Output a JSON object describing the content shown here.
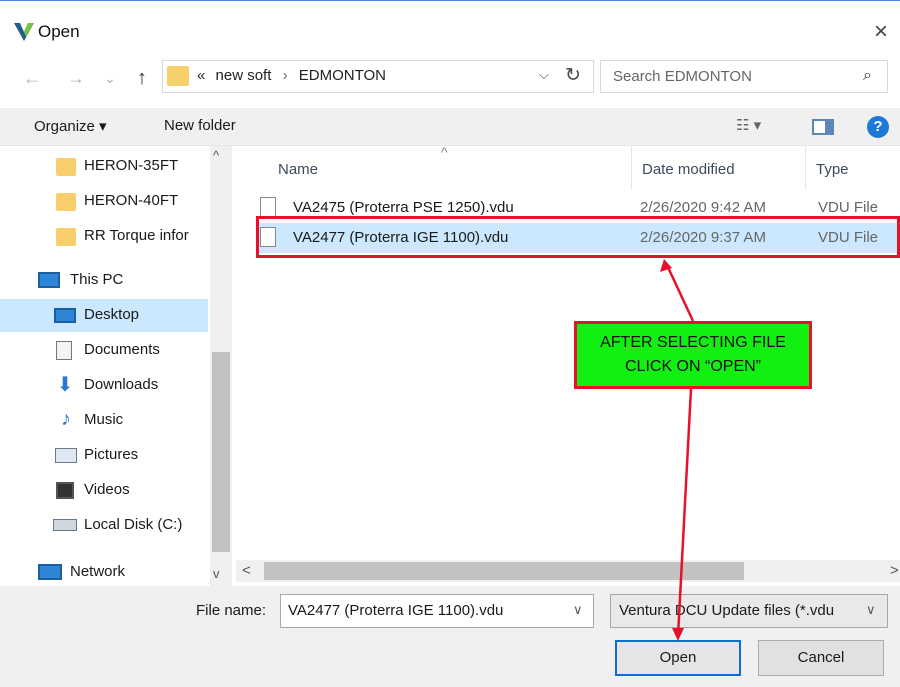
{
  "window": {
    "title": "Open",
    "close_icon": "×"
  },
  "nav": {
    "back_icon": "←",
    "forward_icon": "→",
    "recent_icon": "⌄",
    "up_icon": "↑",
    "breadcrumb_prefix": "«",
    "breadcrumb": [
      "new soft",
      "EDMONTON"
    ],
    "dropdown_icon": "⌵",
    "refresh_icon": "↻",
    "search_placeholder": "Search EDMONTON",
    "search_icon": "⌕"
  },
  "toolbar": {
    "organize_label": "Organize ▾",
    "new_folder_label": "New folder",
    "view_label": "☷ ▾",
    "help_label": "?"
  },
  "sidebar": {
    "items": [
      {
        "label": "HERON-35FT",
        "icon": "folder-icon"
      },
      {
        "label": "HERON-40FT",
        "icon": "folder-icon"
      },
      {
        "label": "RR Torque infor",
        "icon": "folder-icon"
      },
      {
        "label": "This PC",
        "icon": "pc-icon"
      },
      {
        "label": "Desktop",
        "icon": "desktop-icon",
        "selected": true
      },
      {
        "label": "Documents",
        "icon": "documents-icon"
      },
      {
        "label": "Downloads",
        "icon": "downloads-icon"
      },
      {
        "label": "Music",
        "icon": "music-icon"
      },
      {
        "label": "Pictures",
        "icon": "pictures-icon"
      },
      {
        "label": "Videos",
        "icon": "videos-icon"
      },
      {
        "label": "Local Disk (C:)",
        "icon": "drive-icon"
      },
      {
        "label": "Network",
        "icon": "network-icon"
      }
    ],
    "scroll_up": "^",
    "scroll_down": "v"
  },
  "files": {
    "columns": [
      "Name",
      "Date modified",
      "Type"
    ],
    "sort_indicator": "^",
    "rows": [
      {
        "name": "VA2475 (Proterra PSE 1250).vdu",
        "date": "2/26/2020 9:42 AM",
        "type": "VDU File"
      },
      {
        "name": "VA2477 (Proterra IGE 1100).vdu",
        "date": "2/26/2020 9:37 AM",
        "type": "VDU File",
        "selected": true
      }
    ]
  },
  "annotation": {
    "line1": "AFTER SELECTING FILE",
    "line2": "CLICK ON “OPEN”",
    "color": "#e8102a",
    "fill": "#12f012"
  },
  "hscroll": {
    "left": "<",
    "right": ">"
  },
  "bottom": {
    "file_name_label": "File name:",
    "file_name_value": "VA2477 (Proterra IGE 1100).vdu",
    "file_name_caret": "∨",
    "filter_value": "Ventura DCU Update files (*.vdu",
    "filter_caret": "∨",
    "open_label": "Open",
    "cancel_label": "Cancel"
  }
}
